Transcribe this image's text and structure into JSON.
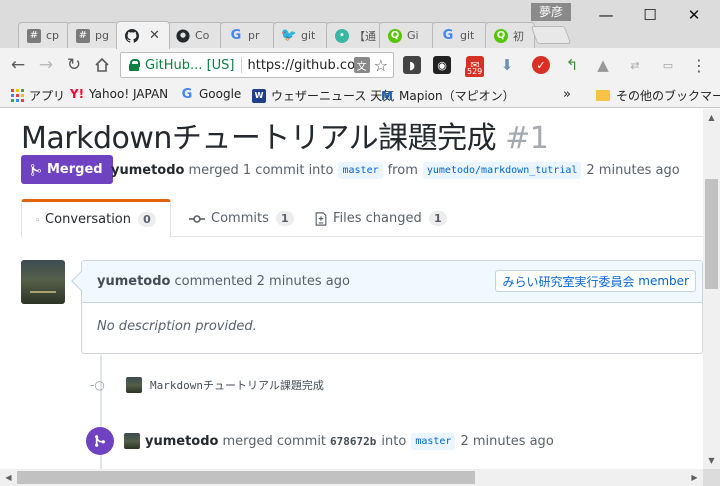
{
  "browser": {
    "profile_name": "夢彦",
    "tabs": [
      {
        "favicon": "hash-icon",
        "title": "cp"
      },
      {
        "favicon": "hash-icon",
        "title": "pg"
      },
      {
        "favicon": "github-icon",
        "title": "",
        "active": true
      },
      {
        "favicon": "github-icon",
        "title": "Co"
      },
      {
        "favicon": "google-icon",
        "title": "pr"
      },
      {
        "favicon": "twitter-icon",
        "title": "git"
      },
      {
        "favicon": "qiita-icon",
        "title": "【通"
      },
      {
        "favicon": "q-icon",
        "title": "Gi"
      },
      {
        "favicon": "google-icon",
        "title": "git"
      },
      {
        "favicon": "q-icon",
        "title": "初"
      }
    ],
    "window_controls": {
      "minimize": "—",
      "maximize": "☐",
      "close": "✕"
    },
    "omnibox": {
      "site_name": "GitHub... [US]",
      "url": "https://github.co"
    },
    "mail_badge": "529",
    "bookmarks": [
      {
        "icon": "apps-icon",
        "label": "アプリ"
      },
      {
        "icon": "yahoo-icon",
        "label": "Yahoo! JAPAN"
      },
      {
        "icon": "google-icon",
        "label": "Google"
      },
      {
        "icon": "weather-icon",
        "label": "ウェザーニュース 天気"
      },
      {
        "icon": "mapion-icon",
        "label": "Mapion（マピオン）"
      }
    ],
    "bookmarks_overflow": "»",
    "other_bookmarks": "その他のブックマーク"
  },
  "pr": {
    "title": "Markdownチュートリアル課題完成",
    "number": "#1",
    "state": "Merged",
    "author": "yumetodo",
    "merged_text": "merged 1 commit into",
    "base_branch": "master",
    "from_text": "from",
    "head_branch": "yumetodo/markdown_tutrial",
    "time": "2 minutes ago"
  },
  "tabnav": [
    {
      "icon": "comment-icon",
      "label": "Conversation",
      "count": "0",
      "selected": true
    },
    {
      "icon": "commit-icon",
      "label": "Commits",
      "count": "1"
    },
    {
      "icon": "diff-icon",
      "label": "Files changed",
      "count": "1"
    }
  ],
  "comment": {
    "author": "yumetodo",
    "action": "commented 2 minutes ago",
    "org": "みらい研究室実行委員会",
    "role": "member",
    "body": "No description provided."
  },
  "commit": {
    "message": "Markdownチュートリアル課題完成"
  },
  "merge_event": {
    "author": "yumetodo",
    "text": "merged commit",
    "sha": "678672b",
    "into_text": "into",
    "branch": "master",
    "time": "2 minutes ago"
  },
  "colors": {
    "merged_purple": "#6f42c1",
    "link_blue": "#0366d6",
    "tab_accent": "#e36209",
    "secure_green": "#0b8043"
  }
}
